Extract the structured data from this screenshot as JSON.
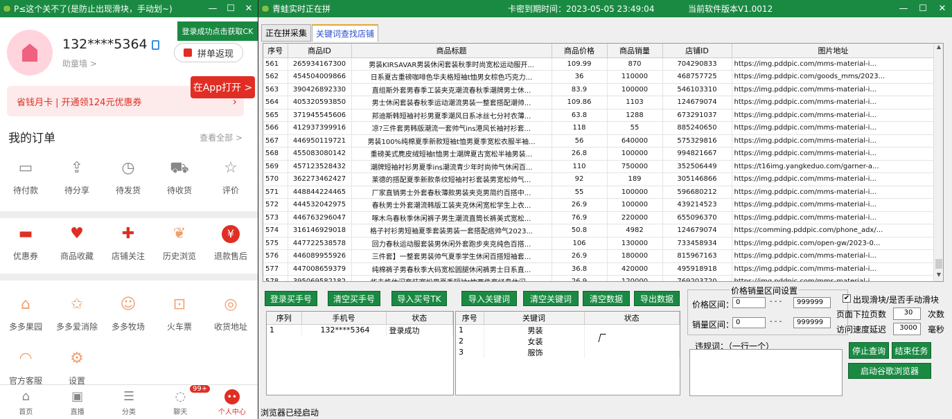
{
  "left_window": {
    "title": "P≤这个关不了(是防止出现滑块，手动划~)",
    "controls": [
      "—",
      "☐",
      "✕"
    ],
    "phone": "132****5364",
    "wall": "助童墙 >",
    "ck_button": "登录成功点击获取CK",
    "pindan_button": "拼单返现",
    "app_button": "在App打开 >",
    "card_text": "省钱月卡 | 开通领124元优惠券",
    "orders_title": "我的订单",
    "view_all": "查看全部 >",
    "order_items": [
      {
        "label": "待付款",
        "icon": "wallet-icon",
        "glyph": "▭"
      },
      {
        "label": "待分享",
        "icon": "share-icon",
        "glyph": "⇪"
      },
      {
        "label": "待发货",
        "icon": "clock-icon",
        "glyph": "◷"
      },
      {
        "label": "待收货",
        "icon": "truck-icon",
        "glyph": "⛟"
      },
      {
        "label": "评价",
        "icon": "review-icon",
        "glyph": "☆"
      }
    ],
    "service_items": [
      {
        "label": "优惠券",
        "icon": "coupon-icon",
        "glyph": "▬"
      },
      {
        "label": "商品收藏",
        "icon": "bag-icon",
        "glyph": "♥"
      },
      {
        "label": "店铺关注",
        "icon": "shop-icon",
        "glyph": "✚"
      },
      {
        "label": "历史浏览",
        "icon": "footprint-icon",
        "glyph": "❦"
      },
      {
        "label": "退款售后",
        "icon": "refund-icon",
        "glyph": "¥"
      }
    ],
    "game_items": [
      {
        "label": "多多果园",
        "icon": "orchard-icon",
        "glyph": "⌂"
      },
      {
        "label": "多多爱消除",
        "icon": "star-icon",
        "glyph": "✩"
      },
      {
        "label": "多多牧场",
        "icon": "cow-icon",
        "glyph": "☺"
      },
      {
        "label": "火车票",
        "icon": "train-icon",
        "glyph": "⊡"
      },
      {
        "label": "收货地址",
        "icon": "location-icon",
        "glyph": "◎"
      }
    ],
    "extra_items": [
      {
        "label": "官方客服",
        "icon": "headset-icon",
        "glyph": "◠"
      },
      {
        "label": "设置",
        "icon": "settings-icon",
        "glyph": "⚙"
      }
    ],
    "nav": [
      {
        "label": "首页",
        "icon": "home-icon",
        "glyph": "⌂"
      },
      {
        "label": "直播",
        "icon": "live-icon",
        "glyph": "▣"
      },
      {
        "label": "分类",
        "icon": "category-icon",
        "glyph": "☰"
      },
      {
        "label": "聊天",
        "icon": "chat-icon",
        "glyph": "◌"
      },
      {
        "label": "个人中心",
        "icon": "profile-icon",
        "glyph": "••"
      }
    ],
    "chat_badge": "99+"
  },
  "right_window": {
    "title": "青蛙实时正在拼",
    "expire": "卡密到期时间：2023-05-05 23:49:04",
    "version": "当前软件版本V1.0012",
    "controls": [
      "—",
      "☐",
      "✕"
    ],
    "tabs": [
      "正在拼采集",
      "关键词查找店铺"
    ],
    "columns": [
      "序号",
      "商品ID",
      "商品标题",
      "商品价格",
      "商品销量",
      "店铺ID",
      "图片地址"
    ],
    "rows": [
      [
        "561",
        "265934167300",
        "男装KIRSAVAR男装休闲套装秋季时尚宽松运动服开...",
        "109.99",
        "870",
        "704290833",
        "https://img.pddpic.com/mms-material-i..."
      ],
      [
        "562",
        "454504009866",
        "日系夏古重磅咖啡色华夫格短袖t恤男女棕色巧克力...",
        "36",
        "110000",
        "468757725",
        "https://img.pddpic.com/goods_mms/2023..."
      ],
      [
        "563",
        "390426892330",
        "直组斯外套男春季工装夹克潮流春秋季潮牌男士休...",
        "83.9",
        "100000",
        "546103310",
        "https://img.pddpic.com/mms-material-i..."
      ],
      [
        "564",
        "405320593850",
        "男士休闲套装春秋季运动潮流男装一整套搭配潮帅...",
        "109.86",
        "1103",
        "124679074",
        "https://img.pddpic.com/mms-material-i..."
      ],
      [
        "565",
        "371945545606",
        "邦迪斯韩短袖衬衫男夏季潮风日系冰丝七分衬衣薄...",
        "63.8",
        "1288",
        "673291037",
        "https://img.pddpic.com/mms-material-i..."
      ],
      [
        "566",
        "412937399916",
        "凉?三件套男韩版潮流一套帅气ins港风长袖衬衫套...",
        "118",
        "55",
        "885240650",
        "https://img.pddpic.com/mms-material-i..."
      ],
      [
        "567",
        "446950119721",
        "男装100%纯棉夏季新款短袖t恤男夏季宽松衣服半袖...",
        "56",
        "640000",
        "575329816",
        "https://img.pddpic.com/mms-material-i..."
      ],
      [
        "568",
        "455083080142",
        "重磅美式麂皮绒短袖t恤男士潮牌夏古宽松半袖男装...",
        "26.8",
        "100000",
        "994821667",
        "https://img.pddpic.com/mms-material-i..."
      ],
      [
        "569",
        "457123528432",
        "潮牌短袖衬衫男夏季ins潮流青少年时尚帅气休闲百...",
        "110",
        "750000",
        "352506449",
        "https://t16img.yangkeduo.com/garner-a..."
      ],
      [
        "570",
        "362273462427",
        "莱德的搭配夏季新款条纹短袖衬衫套装男宽松帅气...",
        "92",
        "189",
        "305146866",
        "https://img.pddpic.com/mms-material-i..."
      ],
      [
        "571",
        "448844224465",
        "厂家直销男士外套春秋薄款男装夹克男简约百搭中...",
        "55",
        "100000",
        "596680212",
        "https://img.pddpic.com/mms-material-i..."
      ],
      [
        "572",
        "444532042975",
        "春秋男士外套潮流韩版工装夹克休闲宽松学生上衣...",
        "26.9",
        "100000",
        "439214523",
        "https://img.pddpic.com/mms-material-i..."
      ],
      [
        "573",
        "446763296047",
        "啄木鸟春秋季休闲裤子男生潮流直筒长裤美式宽松...",
        "76.9",
        "220000",
        "655096370",
        "https://img.pddpic.com/mms-material-i..."
      ],
      [
        "574",
        "316146929018",
        "格子衬衫男短袖夏季套装男装一套搭配痞帅气2023...",
        "50.8",
        "4982",
        "124679074",
        "https://comming.pddpic.com/phone_adx/..."
      ],
      [
        "575",
        "447722538578",
        "回力春秋运动服套装男休闲外套跑步夹克纯色百搭...",
        "106",
        "130000",
        "733458934",
        "https://img.pddpic.com/open-gw/2023-0..."
      ],
      [
        "576",
        "446089955926",
        "三件套】一整套男装帅气夏季学生休闲百搭短袖套...",
        "26.9",
        "180000",
        "815967163",
        "https://img.pddpic.com/mms-material-i..."
      ],
      [
        "577",
        "447008659379",
        "纯棉裤子男春秋季大码宽松圆腿休闲裤男士日系直...",
        "36.8",
        "420000",
        "495918918",
        "https://img.pddpic.com/mms-material-i..."
      ],
      [
        "578",
        "395069582182",
        "华夫格休闲套装宽松男夏季短袖t恤两件套经典休闲...",
        "26.9",
        "120000",
        "769203720",
        "https://img.pddpic.com/mms-material-i..."
      ],
      [
        "579",
        "126057671301",
        "山东省卖得好工装裤男士潮牌长裤子春夏季薄款宽...",
        "46",
        "100000",
        "285846606",
        "https://img.pddpic.com/mms-material-i..."
      ],
      [
        "580",
        "336069359712",
        "港风男套装夏季潮流休闲裤短袖短裤含棉T恤宽松百...",
        "16.9",
        "20000",
        "503691767",
        "https://img.pddpic.com/mms-material-i..."
      ]
    ],
    "buttons": {
      "login_buyer": "登录买手号",
      "clear_buyer": "清空买手号",
      "import_buyer": "导入买号TK",
      "import_kw": "导入关键词",
      "clear_kw": "清空关键词",
      "clear_data": "清空数据",
      "export_data": "导出数据",
      "stop_query": "停止查询",
      "end_task": "结束任务",
      "launch_browser": "启动谷歌浏览器"
    },
    "buyer_table": {
      "columns": [
        "序列",
        "手机号",
        "状态"
      ],
      "rows": [
        [
          "1",
          "132****5364",
          "登录成功"
        ]
      ]
    },
    "keyword_table": {
      "columns": [
        "序号",
        "关键词",
        "状态"
      ],
      "rows": [
        [
          "1",
          "男装",
          ""
        ],
        [
          "2",
          "女装",
          ""
        ],
        [
          "3",
          "服饰",
          ""
        ]
      ]
    },
    "filter": {
      "legend": "价格销量区间设置",
      "price_label": "价格区间：",
      "price_min": "0",
      "price_max": "999999",
      "sales_label": "销量区间：",
      "sales_min": "0",
      "sales_max": "999999",
      "dash": "- - -"
    },
    "banned_label": "违规词：（一行一个）",
    "slider_check_label": "出现滑块/是否手动滑块",
    "slider_checked": true,
    "page_label": "页面下拉页数",
    "page_value": "30",
    "page_unit": "次数",
    "delay_label": "访问速度延迟",
    "delay_value": "3000",
    "delay_unit": "毫秒",
    "status": "浏览器已经启动"
  }
}
